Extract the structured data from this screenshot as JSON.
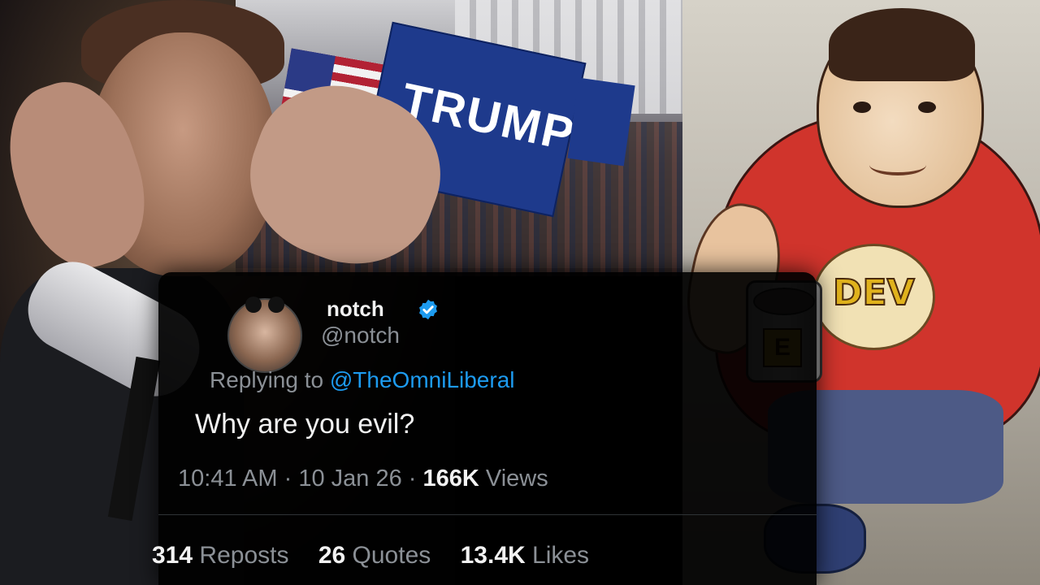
{
  "tweet": {
    "display_name": "notch",
    "handle": "@notch",
    "reply_prefix": "Replying to",
    "reply_mention": "@TheOmniLiberal",
    "text": "Why are you evil?",
    "time": "10:41 AM",
    "date": "10 Jan 26",
    "views_count": "166K",
    "views_label": "Views",
    "reposts_count": "314",
    "reposts_label": "Reposts",
    "quotes_count": "26",
    "quotes_label": "Quotes",
    "likes_count": "13.4K",
    "likes_label": "Likes",
    "verified_color": "#1d9bf0"
  },
  "background": {
    "flag_text": "TRUMP",
    "character_badge": "DEV",
    "mug_letter": "E"
  }
}
